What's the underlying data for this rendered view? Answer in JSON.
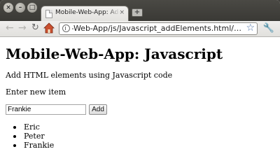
{
  "window": {
    "controls": {
      "close": "×",
      "minimize": "–",
      "maximize": "□"
    }
  },
  "tab": {
    "title": "Mobile-Web-App: Add HTML",
    "close_glyph": "×",
    "new_tab_glyph": "+"
  },
  "toolbar": {
    "back_glyph": "←",
    "forward_glyph": "→",
    "reload_glyph": "↻",
    "home_icon": "home-icon",
    "url": "…/Blogs/Mobile-Web-App/js/Javascript_addElements.html",
    "star_glyph": "☆",
    "wrench_glyph": "🔧"
  },
  "page": {
    "heading": "Mobile-Web-App: Javascript",
    "description": "Add HTML elements using Javascript code",
    "prompt": "Enter new item",
    "input_value": "Frankie",
    "add_label": "Add",
    "items": [
      "Eric",
      "Peter",
      "Frankie"
    ]
  },
  "colors": {
    "titlebar": "#3c3b37",
    "chrome": "#efeeec",
    "page_bg": "#ffffff",
    "text": "#000000"
  }
}
